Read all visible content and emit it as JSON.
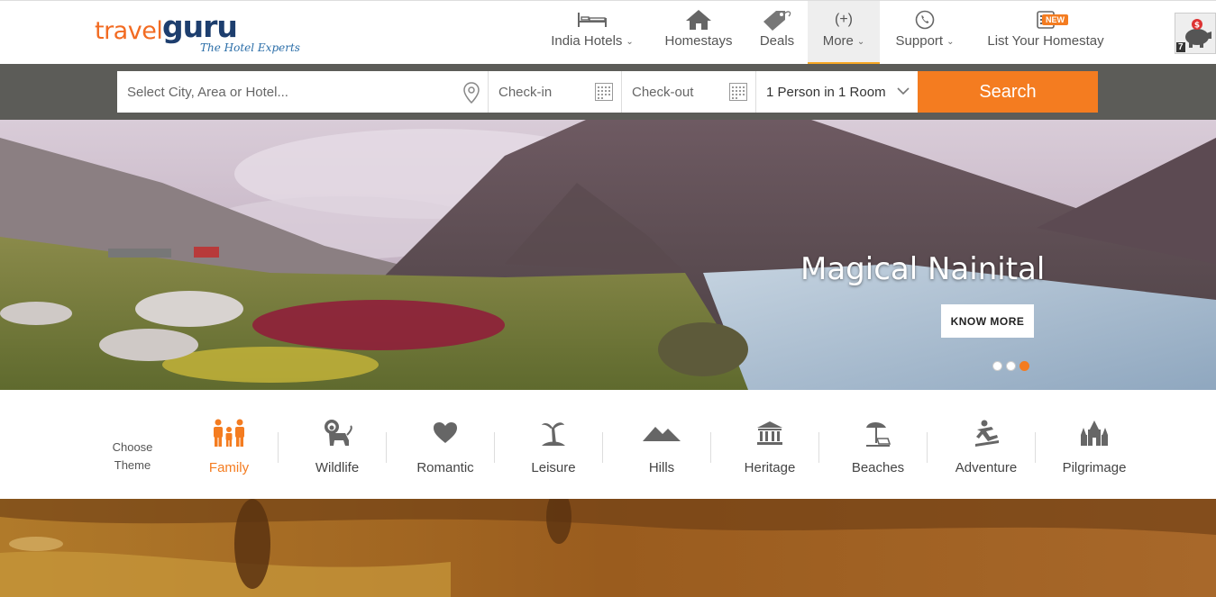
{
  "brand": {
    "logo_word1": "travel",
    "logo_word2": "guru",
    "tagline": "The Hotel Experts",
    "primary_color": "#f47c20",
    "navy_color": "#1d3e6e"
  },
  "nav": {
    "items": [
      {
        "label": "India Hotels",
        "icon": "bed-icon",
        "has_dropdown": true
      },
      {
        "label": "Homestays",
        "icon": "house-icon",
        "has_dropdown": false
      },
      {
        "label": "Deals",
        "icon": "price-tag-icon",
        "has_dropdown": false
      },
      {
        "label": "More",
        "icon_text": "(+)",
        "has_dropdown": true,
        "active": true
      },
      {
        "label": "Support",
        "icon": "phone-icon",
        "has_dropdown": true
      },
      {
        "label": "List Your Homestay",
        "icon": "list-icon",
        "badge": "NEW"
      }
    ]
  },
  "wallet": {
    "icon": "piggy-bank-icon",
    "count": "7"
  },
  "search": {
    "destination_placeholder": "Select City, Area or Hotel...",
    "checkin_placeholder": "Check-in",
    "checkout_placeholder": "Check-out",
    "guests_value": "1 Person in 1 Room",
    "button_label": "Search"
  },
  "hero": {
    "caption": "Magical Nainital",
    "cta_label": "KNOW MORE",
    "slides": 3,
    "active_slide": 3
  },
  "themes": {
    "heading": "Choose Theme",
    "items": [
      {
        "label": "Family",
        "icon": "family-icon",
        "active": true
      },
      {
        "label": "Wildlife",
        "icon": "lion-icon"
      },
      {
        "label": "Romantic",
        "icon": "heart-icon"
      },
      {
        "label": "Leisure",
        "icon": "palm-tree-icon"
      },
      {
        "label": "Hills",
        "icon": "mountain-icon"
      },
      {
        "label": "Heritage",
        "icon": "monument-icon"
      },
      {
        "label": "Beaches",
        "icon": "beach-umbrella-icon"
      },
      {
        "label": "Adventure",
        "icon": "skydiver-icon"
      },
      {
        "label": "Pilgrimage",
        "icon": "temple-icon"
      }
    ]
  }
}
